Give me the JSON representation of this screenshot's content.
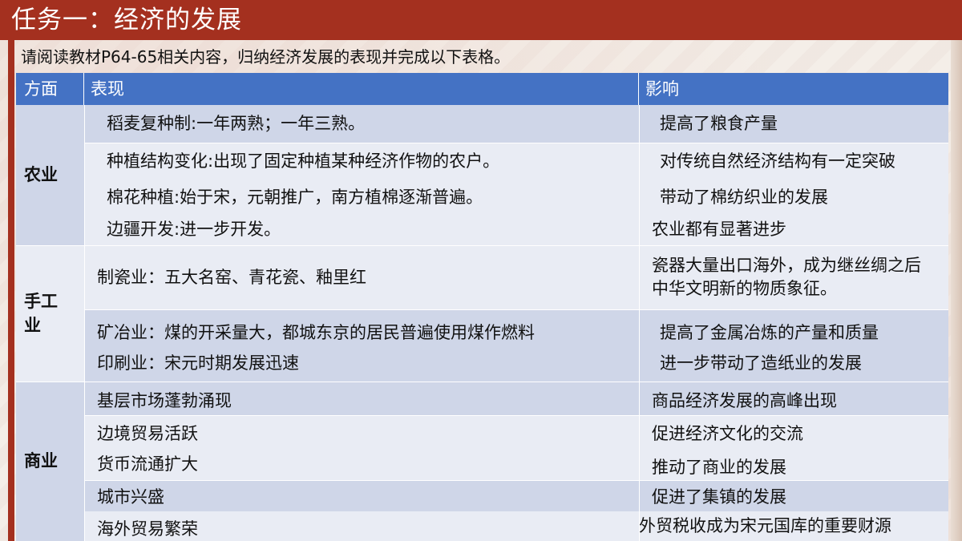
{
  "header": {
    "title": "任务一：经济的发展"
  },
  "instruction": "请阅读教材P64-65相关内容，归纳经济发展的表现并完成以下表格。",
  "table": {
    "columns": [
      "方面",
      "表现",
      "影响"
    ],
    "groups": [
      {
        "aspect": "农业",
        "rows": [
          {
            "performance": "稻麦复种制:一年两熟；一年三熟。",
            "impact": "提高了粮食产量"
          },
          {
            "performance": "种植结构变化:出现了固定种植某种经济作物的农户。",
            "impact": "对传统自然经济结构有一定突破"
          },
          {
            "performance": "棉花种植:始于宋，元朝推广，南方植棉逐渐普遍。",
            "impact": "带动了棉纺织业的发展"
          },
          {
            "performance": "边疆开发:进一步开发。",
            "impact": "农业都有显著进步"
          }
        ]
      },
      {
        "aspect": "手工业",
        "rows": [
          {
            "performance": "制瓷业：五大名窑、青花瓷、釉里红",
            "impact": "瓷器大量出口海外，成为继丝绸之后中华文明新的物质象征。"
          },
          {
            "performance": "矿冶业：煤的开采量大，都城东京的居民普遍使用煤作燃料",
            "impact": "提高了金属冶炼的产量和质量"
          },
          {
            "performance": "印刷业：宋元时期发展迅速",
            "impact": "进一步带动了造纸业的发展"
          }
        ]
      },
      {
        "aspect": "商业",
        "rows": [
          {
            "performance": "基层市场蓬勃涌现",
            "impact": "商品经济发展的高峰出现"
          },
          {
            "performance": "边境贸易活跃",
            "impact": "促进经济文化的交流"
          },
          {
            "performance": "货币流通扩大",
            "impact": "推动了商业的发展"
          },
          {
            "performance": "城市兴盛",
            "impact": "促进了集镇的发展"
          },
          {
            "performance": "海外贸易繁荣",
            "impact": "外贸税收成为宋元国库的重要财源"
          }
        ]
      }
    ]
  }
}
